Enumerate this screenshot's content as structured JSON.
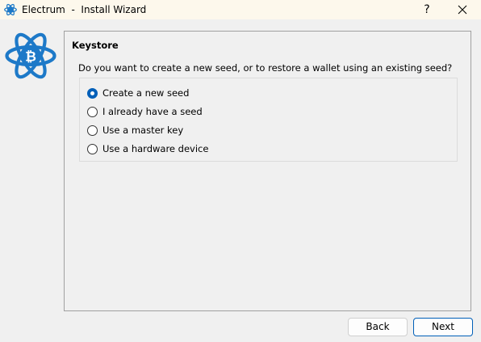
{
  "window": {
    "title": "Electrum  -  Install Wizard",
    "help_label": "?",
    "close_icon": "close-icon",
    "app_icon": "electrum-icon"
  },
  "logo": {
    "icon": "electrum-logo-icon",
    "color": "#1d79c8"
  },
  "panel": {
    "title": "Keystore",
    "question": "Do you want to create a new seed, or to restore a wallet using an existing seed?",
    "options": [
      {
        "label": "Create a new seed",
        "selected": true
      },
      {
        "label": "I already have a seed",
        "selected": false
      },
      {
        "label": "Use a master key",
        "selected": false
      },
      {
        "label": "Use a hardware device",
        "selected": false
      }
    ]
  },
  "buttons": {
    "back_label": "Back",
    "next_label": "Next"
  },
  "colors": {
    "accent": "#005fb8",
    "titlebar": "#fdf8ec",
    "background": "#f0f0f0"
  }
}
